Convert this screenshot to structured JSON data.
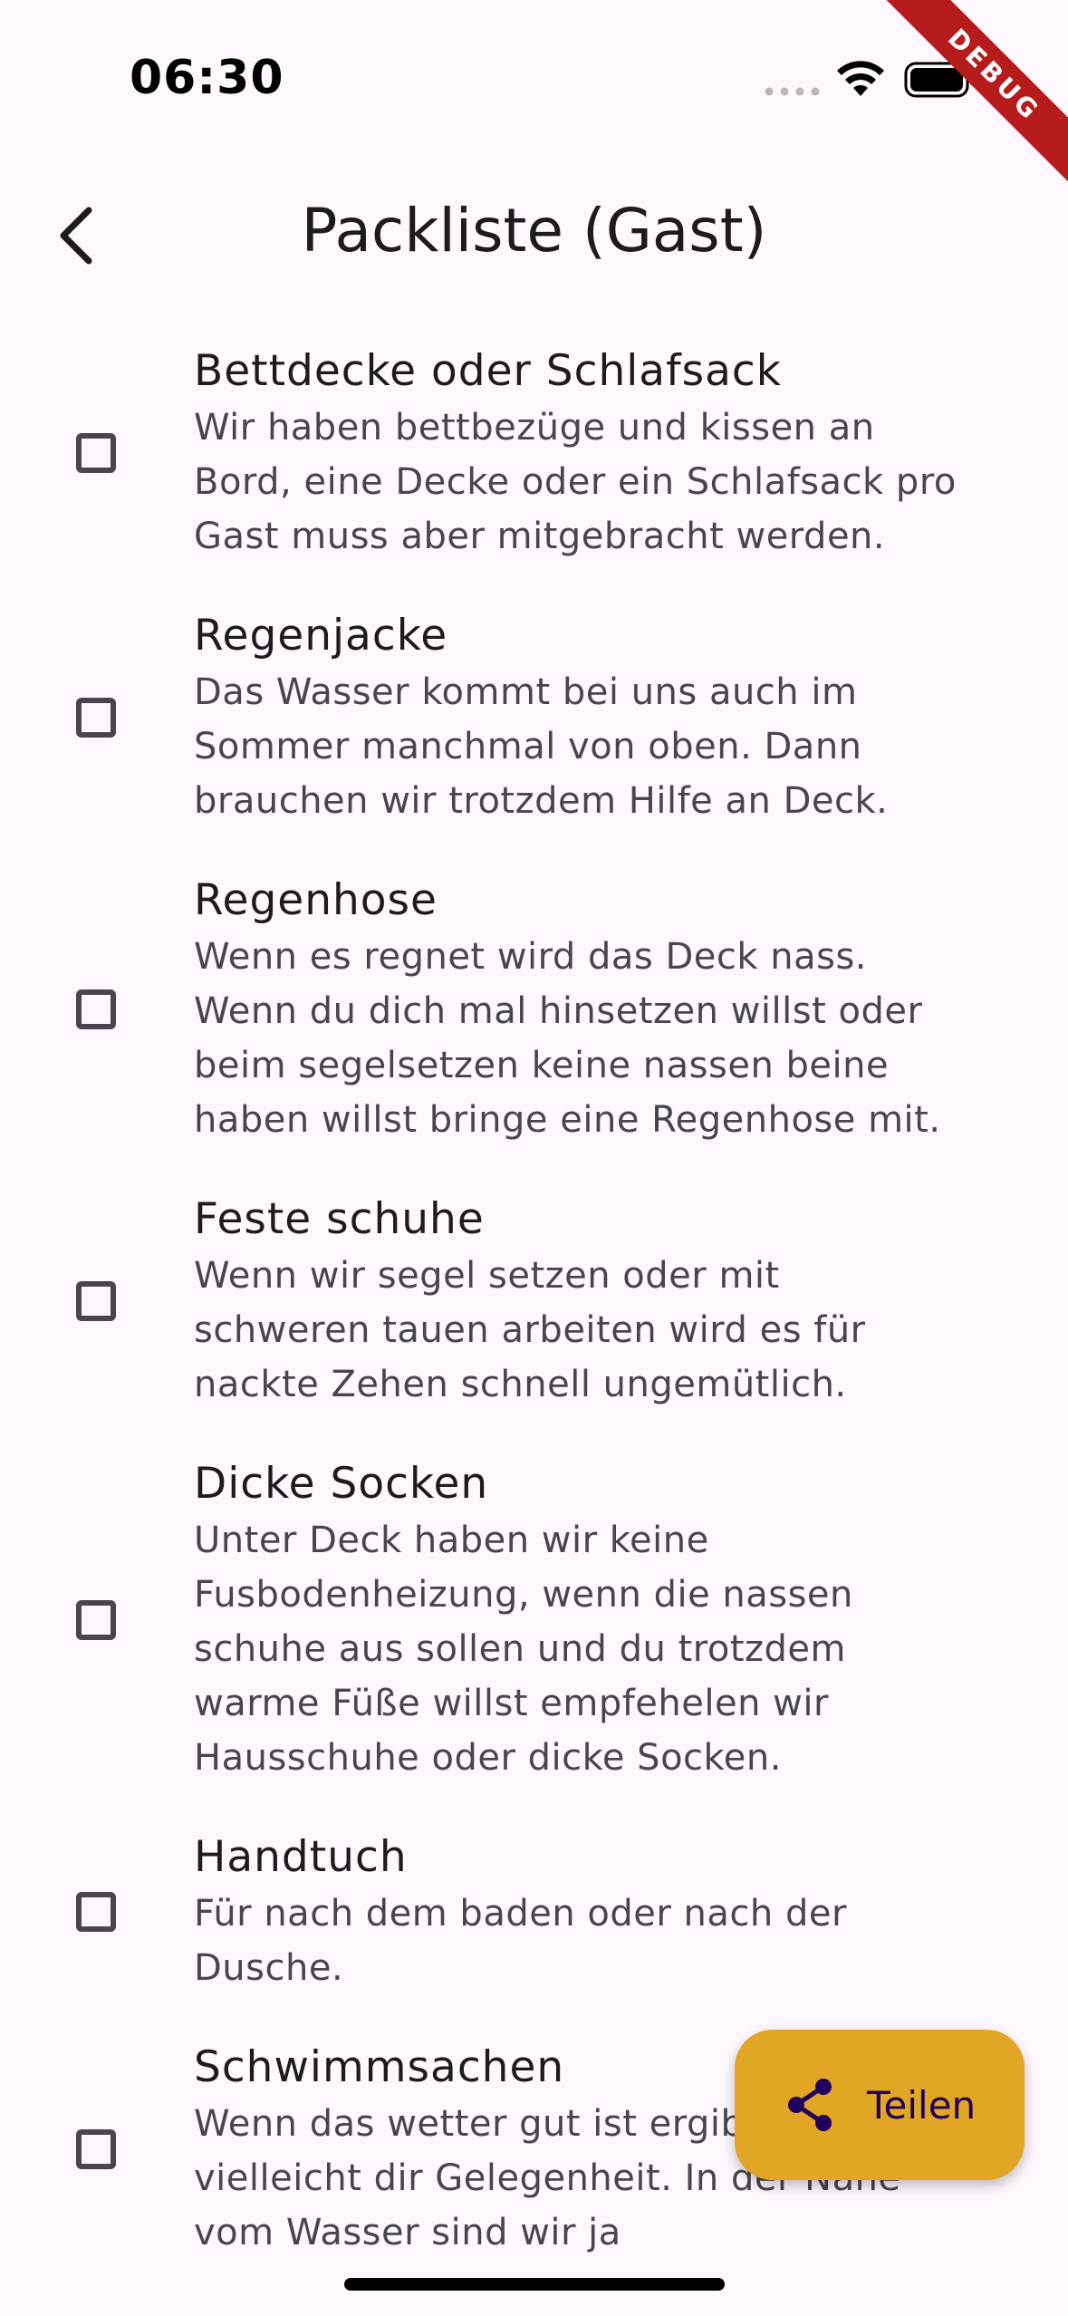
{
  "status_bar": {
    "time": "06:30"
  },
  "debug_banner": "DEBUG",
  "app_bar": {
    "title": "Packliste (Gast)",
    "back_icon": "chevron-left-icon"
  },
  "items": [
    {
      "title": "Bettdecke oder Schlafsack",
      "description": "Wir haben bettbezüge und kissen an\nBord, eine Decke oder ein Schlafsack pro\nGast muss aber mitgebracht werden.",
      "checked": false
    },
    {
      "title": "Regenjacke",
      "description": "Das Wasser kommt bei uns auch im\nSommer manchmal von oben. Dann\nbrauchen wir trotzdem Hilfe an Deck.",
      "checked": false
    },
    {
      "title": "Regenhose",
      "description": "Wenn es regnet wird das Deck nass.\nWenn du dich mal hinsetzen willst oder\nbeim segelsetzen keine nassen beine\nhaben willst bringe eine Regenhose mit.",
      "checked": false
    },
    {
      "title": "Feste schuhe",
      "description": "Wenn wir segel setzen oder mit\nschweren tauen arbeiten wird es für\nnackte Zehen schnell ungemütlich.",
      "checked": false
    },
    {
      "title": "Dicke Socken",
      "description": "Unter Deck haben wir keine\nFusbodenheizung, wenn die nassen\nschuhe aus sollen und du trotzdem\nwarme Füße willst empfehelen wir\nHausschuhe oder dicke Socken.",
      "checked": false
    },
    {
      "title": "Handtuch",
      "description": "Für nach dem baden oder nach der\nDusche.",
      "checked": false
    },
    {
      "title": "Schwimmsachen",
      "description": "Wenn das wetter gut ist ergibt\nvielleicht dir Gelegenheit. In der Nähe\nvom Wasser sind wir ja",
      "checked": false
    }
  ],
  "fab": {
    "label": "Teilen",
    "icon": "share-icon",
    "color": "#e0a624"
  },
  "colors": {
    "background": "#fef7fe",
    "text": "#1d1b20",
    "secondary_text": "#49454f",
    "debug": "#b71c1c"
  }
}
